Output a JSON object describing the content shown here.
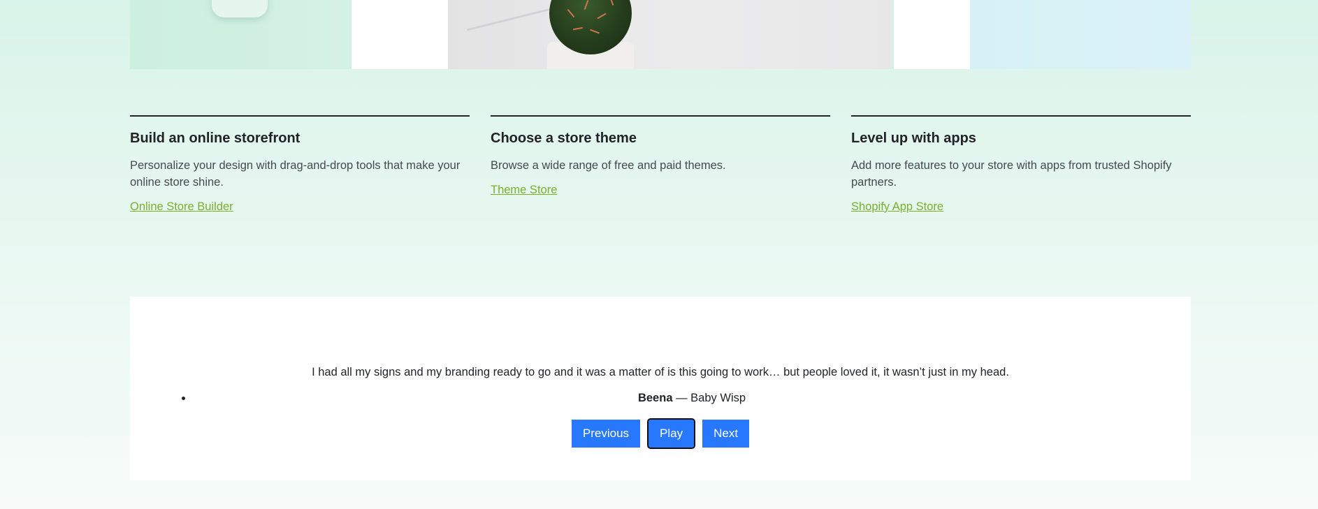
{
  "features": [
    {
      "title": "Build an online storefront",
      "description": "Personalize your design with drag-and-drop tools that make your online store shine.",
      "link": "Online Store Builder"
    },
    {
      "title": "Choose a store theme",
      "description": "Browse a wide range of free and paid themes.",
      "link": "Theme Store"
    },
    {
      "title": "Level up with apps",
      "description": "Add more features to your store with apps from trusted Shopify partners.",
      "link": "Shopify App Store"
    }
  ],
  "testimonial": {
    "quote": "I had all my signs and my branding ready to go and it was a matter of is this going to work… but people loved it, it wasn’t just in my head.",
    "author": "Beena",
    "separator": " — ",
    "company": "Baby Wisp"
  },
  "controls": {
    "previous": "Previous",
    "play": "Play",
    "next": "Next"
  },
  "colors": {
    "link": "#7ab02a",
    "button": "#2878ff",
    "heading": "#212326"
  }
}
